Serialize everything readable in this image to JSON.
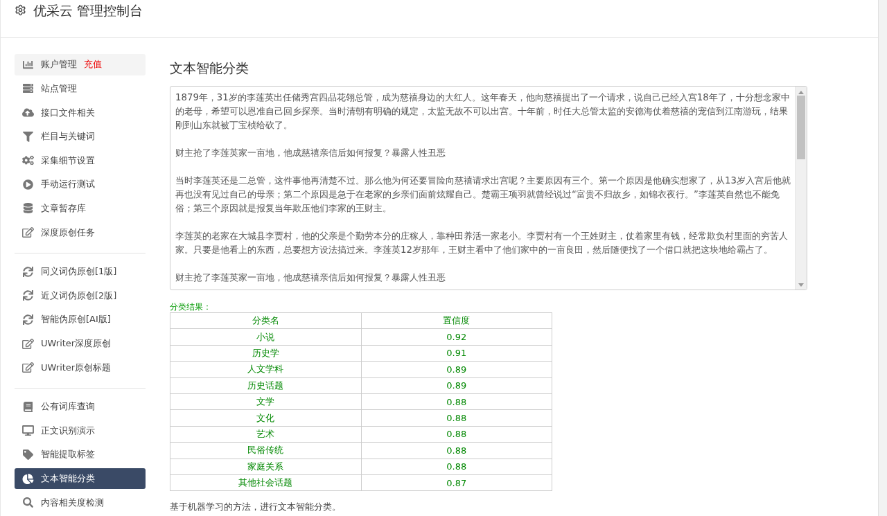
{
  "header": {
    "title": "优采云 管理控制台"
  },
  "sidebar": {
    "groups": [
      [
        {
          "label": "账户管理",
          "badge": "充值",
          "selected": false
        },
        {
          "label": "站点管理",
          "selected": false
        },
        {
          "label": "接口文件相关",
          "selected": false
        },
        {
          "label": "栏目与关键词",
          "selected": false
        },
        {
          "label": "采集细节设置",
          "selected": false
        },
        {
          "label": "手动运行测试",
          "selected": false
        },
        {
          "label": "文章暂存库",
          "selected": false
        },
        {
          "label": "深度原创任务",
          "selected": false
        }
      ],
      [
        {
          "label": "同义词伪原创[1版]",
          "selected": false
        },
        {
          "label": "近义词伪原创[2版]",
          "selected": false
        },
        {
          "label": "智能伪原创[AI版]",
          "selected": false
        },
        {
          "label": "UWriter深度原创",
          "selected": false
        },
        {
          "label": "UWriter原创标题",
          "selected": false
        }
      ],
      [
        {
          "label": "公有词库查询",
          "selected": false
        },
        {
          "label": "正文识别演示",
          "selected": false
        },
        {
          "label": "智能提取标签",
          "selected": false
        },
        {
          "label": "文本智能分类",
          "selected": true
        },
        {
          "label": "内容相关度检测",
          "selected": false
        }
      ]
    ]
  },
  "main": {
    "title": "文本智能分类",
    "paragraphs": [
      "1879年，31岁的李莲英出任储秀宫四品花翎总管，成为慈禧身边的大红人。这年春天，他向慈禧提出了一个请求，说自己已经入宫18年了，十分想念家中的老母，希望可以恩准自己回乡探亲。当时清朝有明确的规定，太监无故不可以出宫。十年前，时任大总管太监的安德海仗着慈禧的宠信到江南游玩，结果刚到山东就被丁宝桢给砍了。",
      "财主抢了李莲英家一亩地，他成慈禧亲信后如何报复？暴露人性丑恶",
      "当时李莲英还是二总管，这件事他再清楚不过。那么他为何还要冒险向慈禧请求出宫呢？主要原因有三个。第一个原因是他确实想家了，从13岁入宫后他就再也没有见过自己的母亲；第二个原因是急于在老家的乡亲们面前炫耀自己。楚霸王项羽就曾经说过“富贵不归故乡，如锦衣夜行。”李莲英自然也不能免俗；第三个原因就是报复当年欺压他们李家的王财主。",
      "李莲英的老家在大城县李贾村，他的父亲是个勤劳本分的庄稼人，靠种田养活一家老小。李贾村有一个王姓财主，仗着家里有钱，经常欺负村里面的穷苦人家。只要是他看上的东西，总要想方设法搞过来。李莲英12岁那年，王财主看中了他们家中的一亩良田，然后随便找了一个借口就把这块地给霸占了。",
      "财主抢了李莲英家一亩地，他成慈禧亲信后如何报复？暴露人性丑恶"
    ],
    "result_label": "分类结果：",
    "table": {
      "columns": [
        "分类名",
        "置信度"
      ],
      "rows": [
        [
          "小说",
          "0.92"
        ],
        [
          "历史学",
          "0.91"
        ],
        [
          "人文学科",
          "0.89"
        ],
        [
          "历史话题",
          "0.89"
        ],
        [
          "文学",
          "0.88"
        ],
        [
          "文化",
          "0.88"
        ],
        [
          "艺术",
          "0.88"
        ],
        [
          "民俗传统",
          "0.88"
        ],
        [
          "家庭关系",
          "0.88"
        ],
        [
          "其他社会话题",
          "0.87"
        ]
      ]
    },
    "note": "基于机器学习的方法，进行文本智能分类。"
  }
}
